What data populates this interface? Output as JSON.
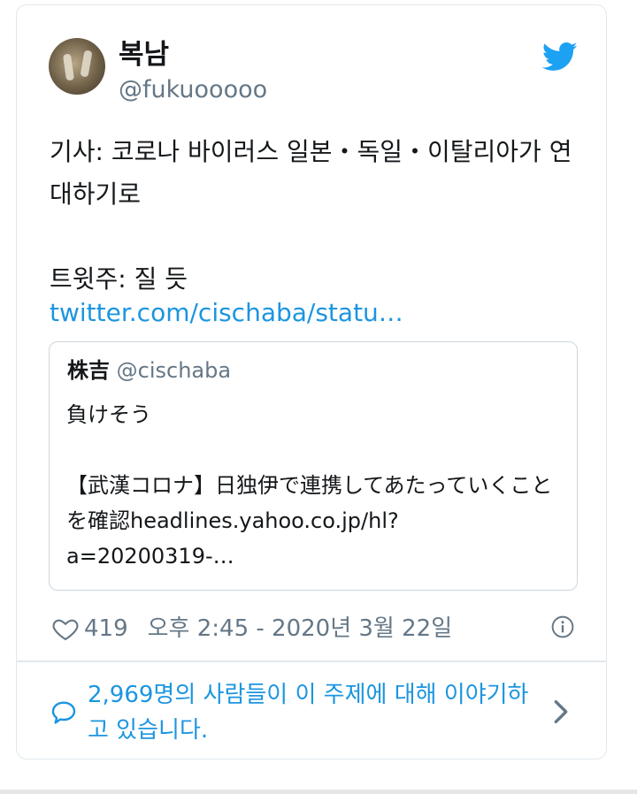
{
  "tweet": {
    "display_name": "복남",
    "handle": "@fukuooooo",
    "text": "기사: 코로나 바이러스 일본・독일・이탈리아가 연대하기로\n\n트윗주: 질 듯",
    "link": "twitter.com/cischaba/statu…"
  },
  "quote": {
    "name": "株吉",
    "handle": "@cischaba",
    "text": "負けそう\n\n【武漢コロナ】日独伊で連携してあたっていくことを確認headlines.yahoo.co.jp/hl?a=20200319-…"
  },
  "meta": {
    "likes": "419",
    "timestamp": "오후 2:45 - 2020년 3월 22일"
  },
  "conversation": {
    "text": "2,969명의 사람들이 이 주제에 대해 이야기하고 있습니다."
  },
  "colors": {
    "link": "#1b95e0",
    "secondary": "#657786",
    "border": "#e1e8ed",
    "twitter_blue": "#1da1f2"
  },
  "icons": [
    "twitter-bird-icon",
    "heart-icon",
    "info-icon",
    "speech-bubble-icon",
    "chevron-right-icon"
  ]
}
